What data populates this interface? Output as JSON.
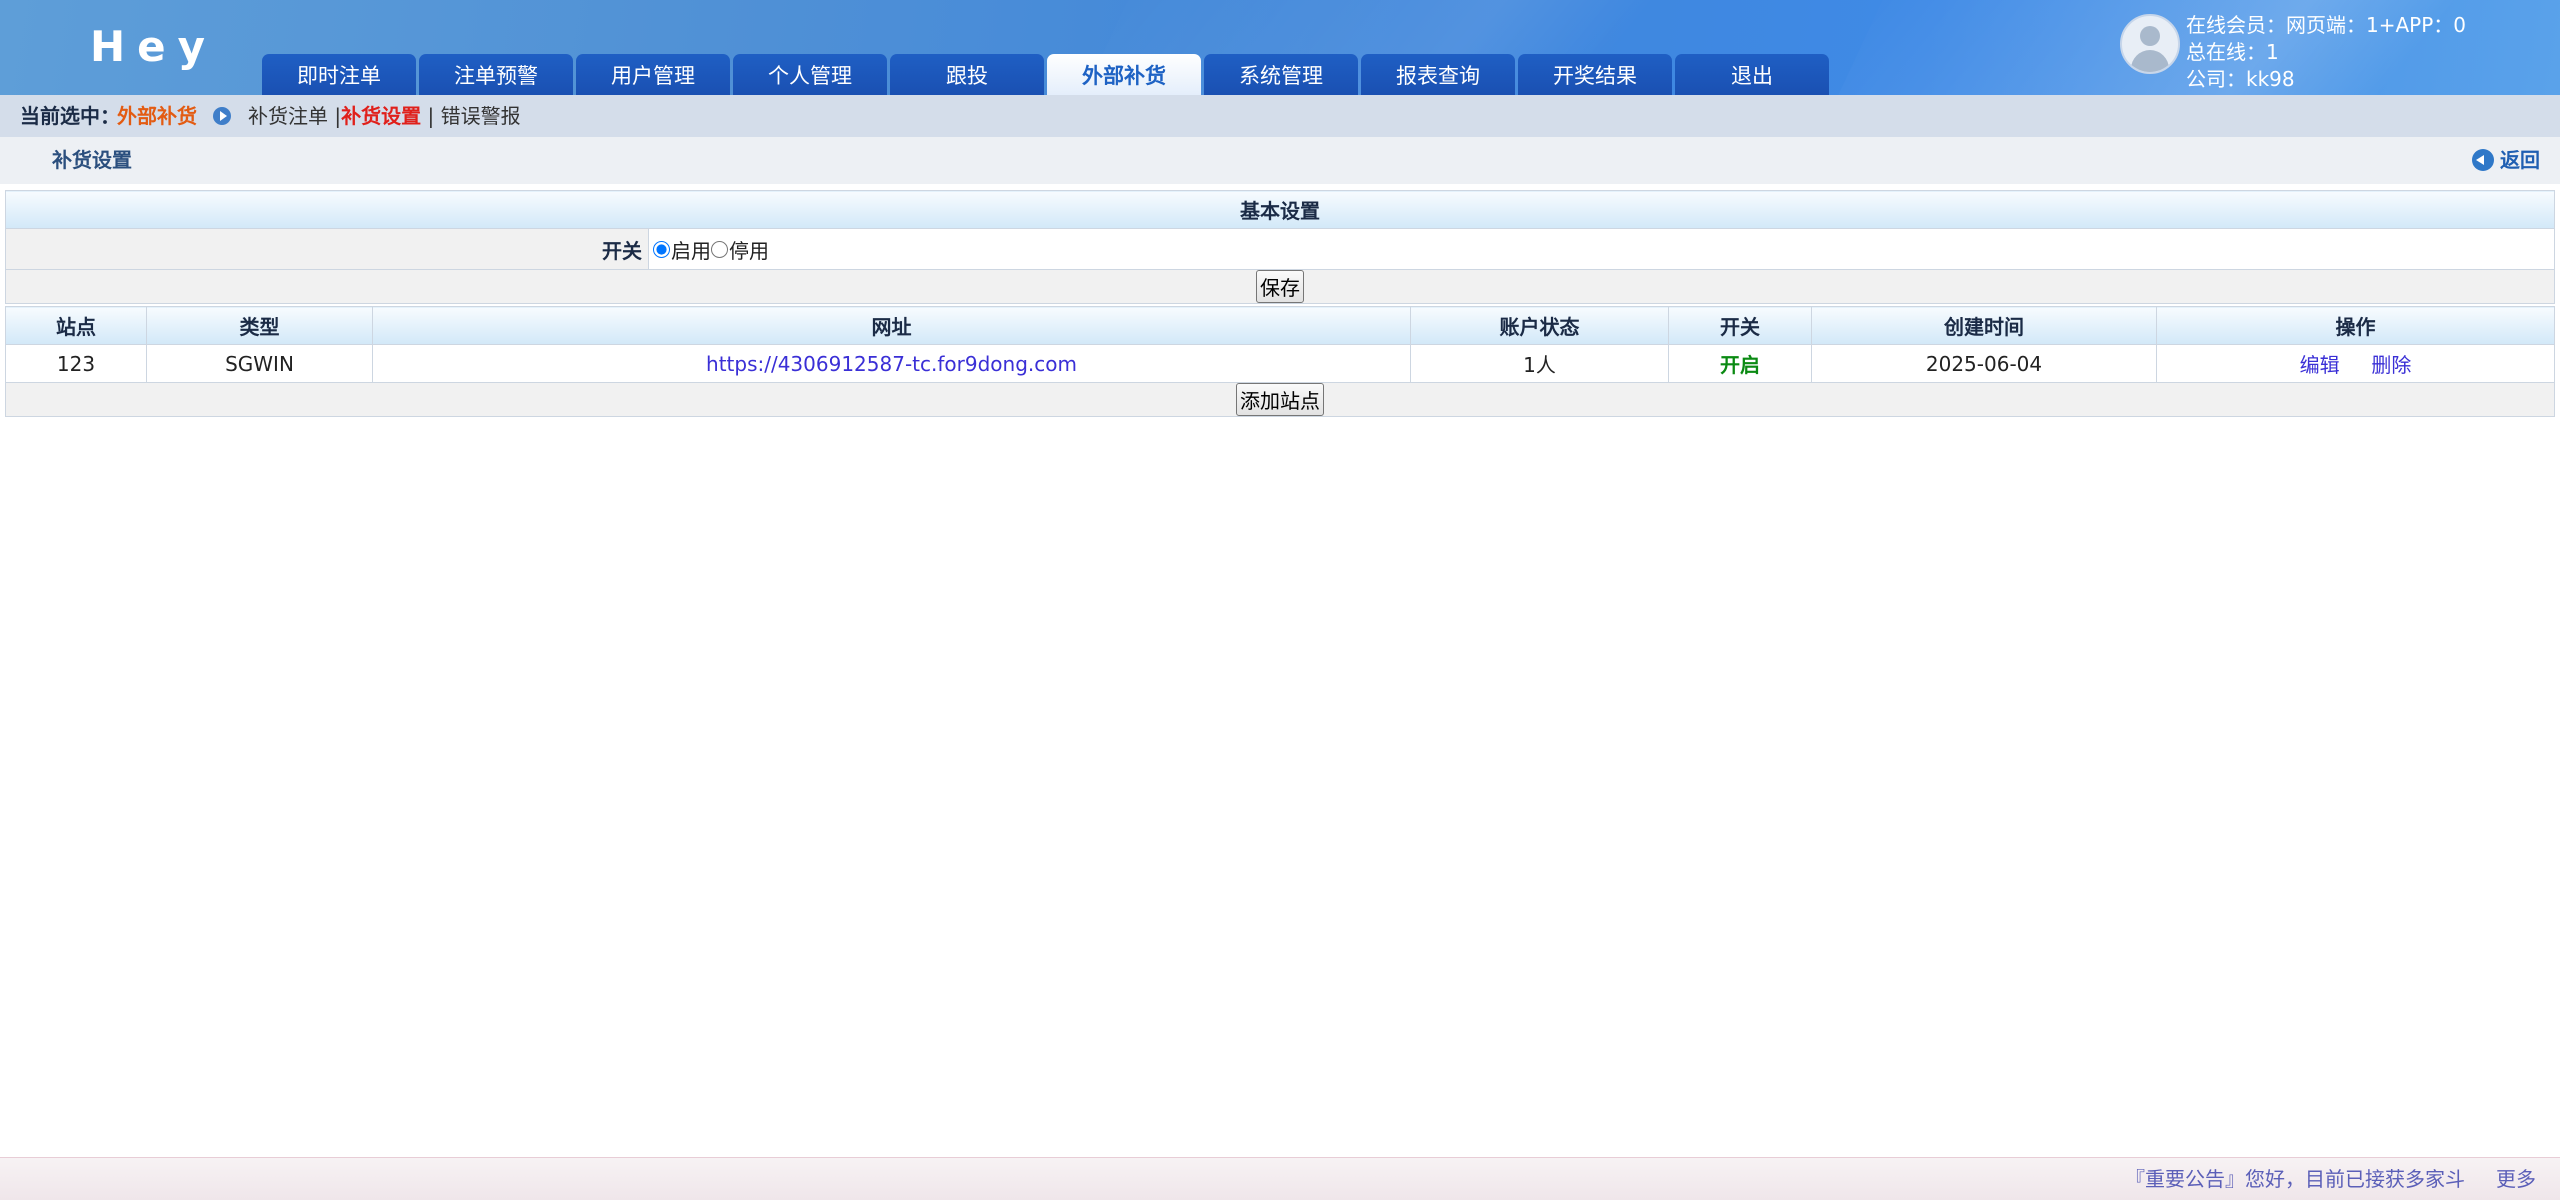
{
  "header": {
    "logo": "Hey",
    "tabs": [
      {
        "label": "即时注单"
      },
      {
        "label": "注单预警"
      },
      {
        "label": "用户管理"
      },
      {
        "label": "个人管理"
      },
      {
        "label": "跟投"
      },
      {
        "label": "外部补货",
        "active": true
      },
      {
        "label": "系统管理"
      },
      {
        "label": "报表查询"
      },
      {
        "label": "开奖结果"
      },
      {
        "label": "退出"
      }
    ],
    "user": {
      "online_members": "在线会员：网页端：1+APP：0",
      "total_online": "总在线：1",
      "company": "公司：kk98"
    }
  },
  "breadcrumb": {
    "label": "当前选中：",
    "current": "外部补货",
    "links": [
      "补货注单",
      "补货设置",
      "错误警报"
    ],
    "active_link": "补货设置",
    "separator": "|"
  },
  "page": {
    "title": "补货设置",
    "back_label": "返回"
  },
  "basic_settings": {
    "title": "基本设置",
    "switch_label": "开关",
    "options": [
      "启用",
      "停用"
    ],
    "selected": "启用",
    "save_label": "保存"
  },
  "sites_table": {
    "columns": [
      "站点",
      "类型",
      "网址",
      "账户状态",
      "开关",
      "创建时间",
      "操作"
    ],
    "rows": [
      {
        "site": "123",
        "type": "SGWIN",
        "url": "https://4306912587-tc.for9dong.com",
        "account_status": "1人",
        "switch": "开启",
        "created": "2025-06-04",
        "edit": "编辑",
        "delete": "删除"
      }
    ],
    "add_label": "添加站点"
  },
  "footer": {
    "notice": "『重要公告』您好，目前已接获多家斗",
    "more": "更多"
  },
  "colors": {
    "nav_tab": "#1f5fc4",
    "current_selection": "#e35b12",
    "active_link": "#e0201b",
    "status_on": "#0a8a12",
    "link": "#3a2fd6"
  }
}
